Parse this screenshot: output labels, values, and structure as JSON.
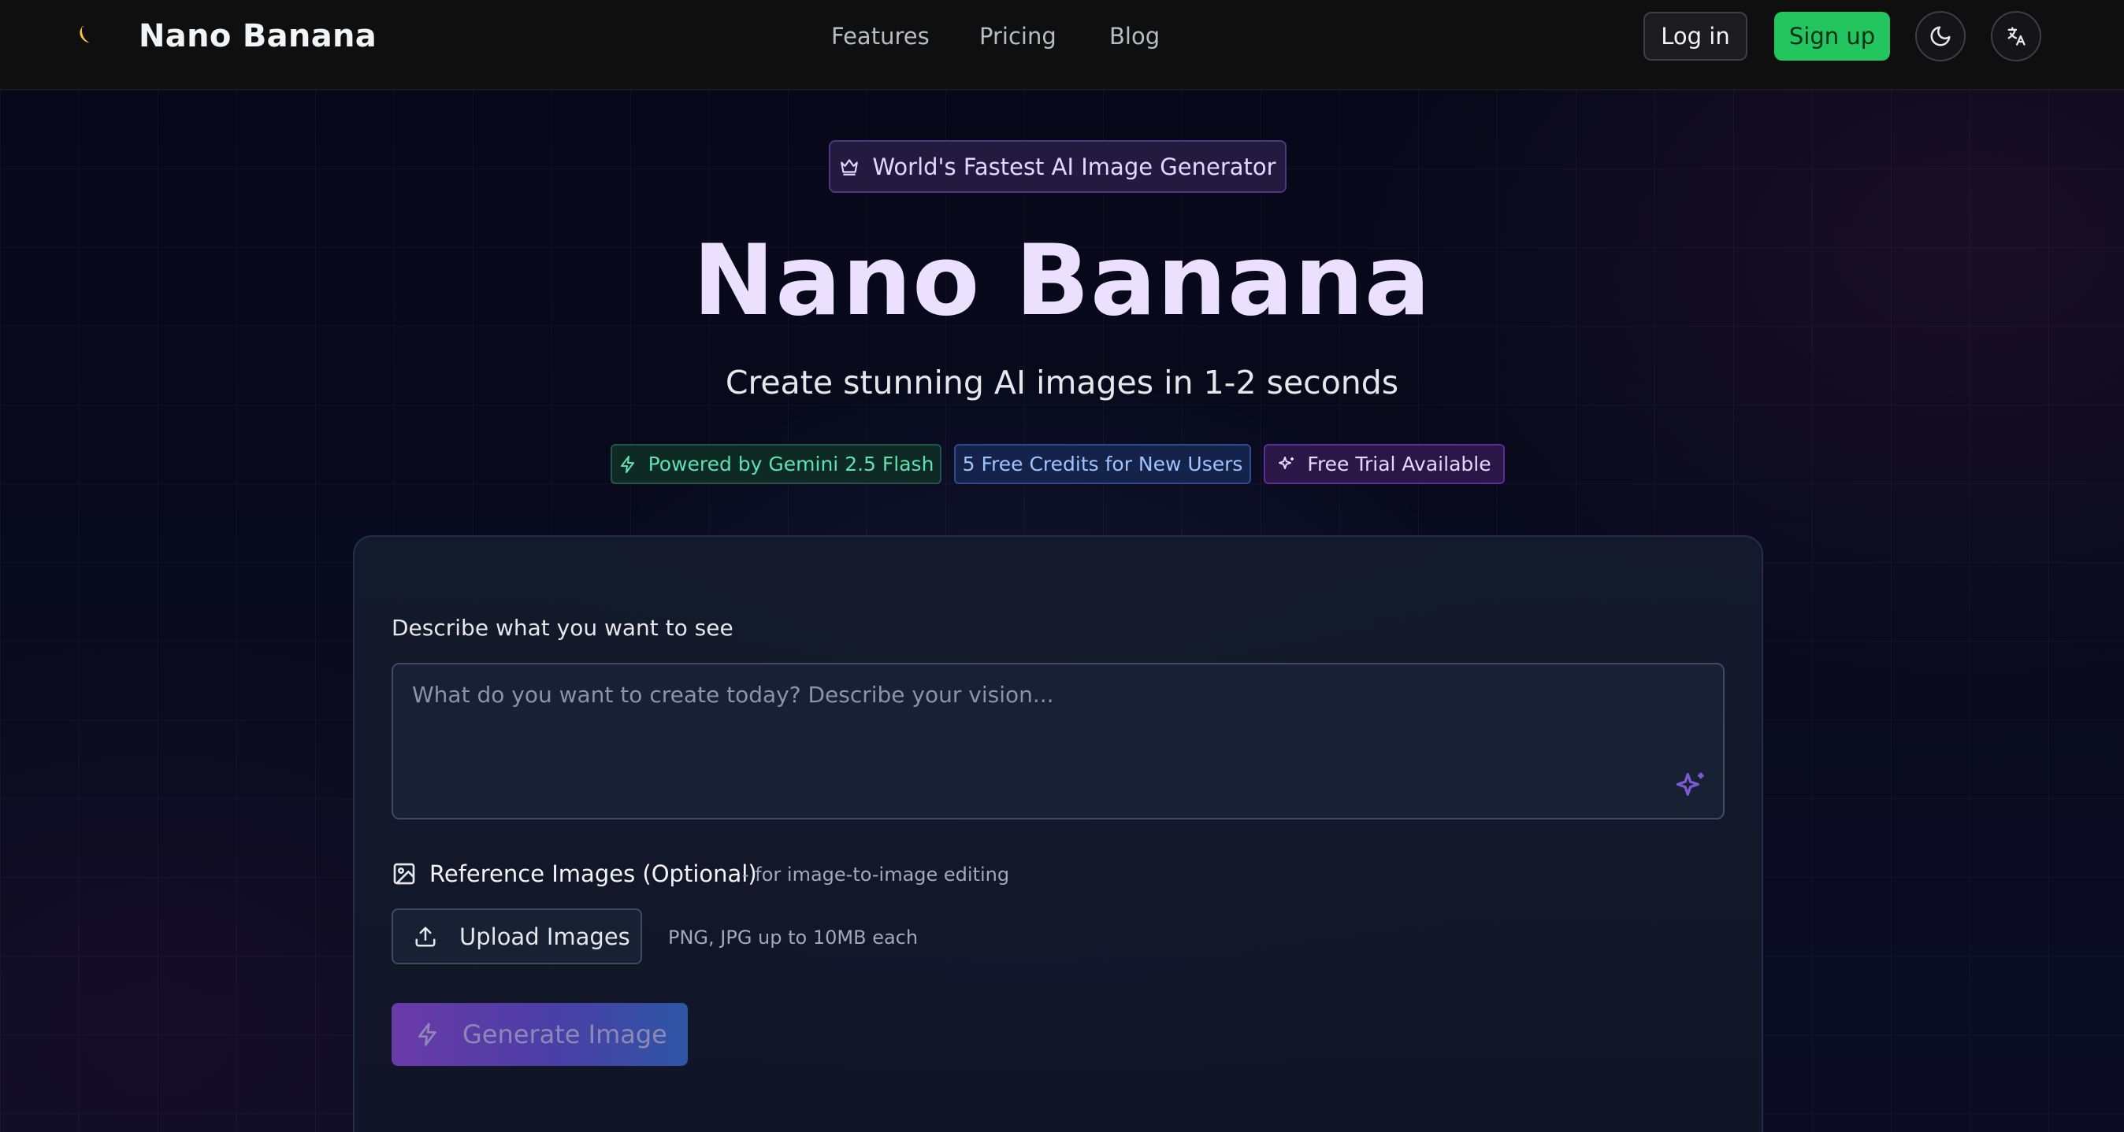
{
  "header": {
    "brand": "Nano Banana",
    "nav": [
      "Features",
      "Pricing",
      "Blog"
    ],
    "login_label": "Log in",
    "signup_label": "Sign up"
  },
  "hero": {
    "badge": "World's Fastest AI Image Generator",
    "title": "Nano Banana",
    "subtitle": "Create stunning AI images in 1-2 seconds",
    "chips": [
      "Powered by Gemini 2.5 Flash",
      "5 Free Credits for New Users",
      "Free Trial Available"
    ]
  },
  "form": {
    "prompt_label": "Describe what you want to see",
    "prompt_placeholder": "What do you want to create today? Describe your vision...",
    "prompt_value": "",
    "reference_label": "Reference Images (Optional)",
    "reference_hint": "- for image-to-image editing",
    "upload_label": "Upload Images",
    "upload_hint": "PNG, JPG up to 10MB each",
    "generate_label": "Generate Image"
  },
  "icons": {
    "logo": "banana-icon",
    "theme": "moon-icon",
    "language": "translate-icon",
    "badge": "crown-icon",
    "chip_green": "lightning-icon",
    "chip_purple": "sparkles-icon",
    "prompt_enhance": "sparkles-icon",
    "reference": "image-icon",
    "upload": "upload-icon",
    "generate": "lightning-icon"
  },
  "colors": {
    "accent_green": "#22c55e",
    "title_lavender": "#ebe1ff",
    "badge_purple": "#4b3880"
  }
}
